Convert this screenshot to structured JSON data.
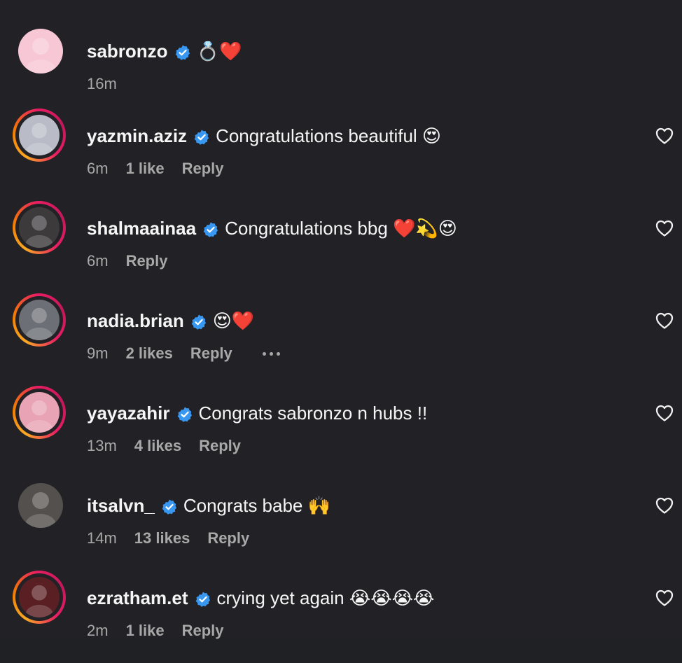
{
  "comments": [
    {
      "username": "sabronzo",
      "text": "💍❤️",
      "time": "16m",
      "likes": "",
      "reply": "",
      "story_ring": false,
      "avatar_color": "#f7c7d6",
      "show_heart": false,
      "show_more": false
    },
    {
      "username": "yazmin.aziz",
      "text": "Congratulations beautiful 😍",
      "time": "6m",
      "likes": "1 like",
      "reply": "Reply",
      "story_ring": true,
      "avatar_color": "#b9bcc6",
      "show_heart": true,
      "show_more": false
    },
    {
      "username": "shalmaainaa",
      "text": "Congratulations bbg ❤️💫😍",
      "time": "6m",
      "likes": "",
      "reply": "Reply",
      "story_ring": true,
      "avatar_color": "#3d3a3c",
      "show_heart": true,
      "show_more": false
    },
    {
      "username": "nadia.brian",
      "text": "😍❤️",
      "time": "9m",
      "likes": "2 likes",
      "reply": "Reply",
      "story_ring": true,
      "avatar_color": "#6c6f75",
      "show_heart": true,
      "show_more": true
    },
    {
      "username": "yayazahir",
      "text": "Congrats sabronzo n hubs !!",
      "time": "13m",
      "likes": "4 likes",
      "reply": "Reply",
      "story_ring": true,
      "avatar_color": "#e8a3b4",
      "show_heart": true,
      "show_more": false
    },
    {
      "username": "itsalvn_",
      "text": "Congrats babe 🙌",
      "time": "14m",
      "likes": "13 likes",
      "reply": "Reply",
      "story_ring": false,
      "avatar_color": "#54504d",
      "show_heart": true,
      "show_more": false
    },
    {
      "username": "ezratham.et",
      "text": "crying yet again 😭😭😭😭",
      "time": "2m",
      "likes": "1 like",
      "reply": "Reply",
      "story_ring": true,
      "avatar_color": "#5a1f22",
      "show_heart": true,
      "show_more": false
    }
  ],
  "colors": {
    "background": "#222226",
    "verified": "#3897f0",
    "meta": "#a8a8a8",
    "text": "#f5f5f5"
  },
  "icons": {
    "verified": "verified-badge-icon",
    "heart": "heart-outline-icon",
    "more": "more-horizontal-icon"
  }
}
